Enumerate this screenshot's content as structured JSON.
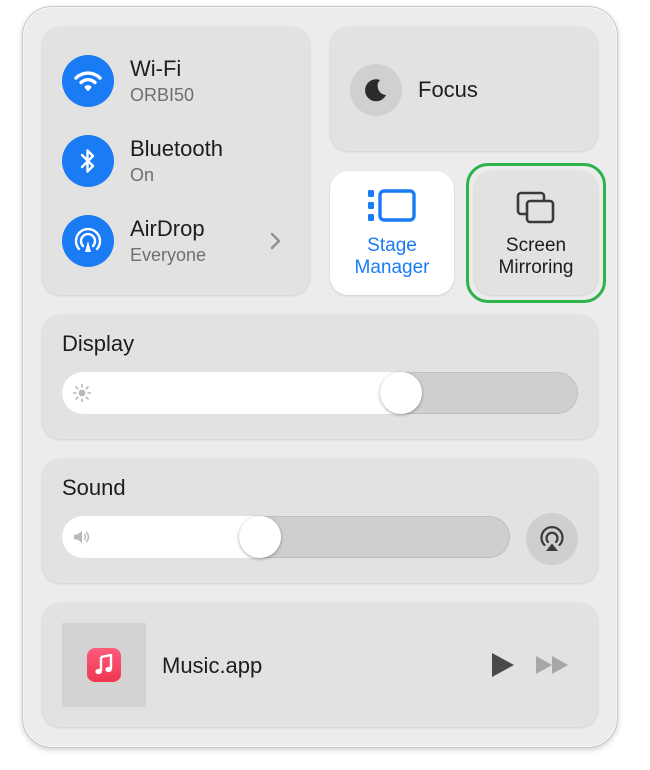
{
  "connectivity": {
    "wifi": {
      "title": "Wi-Fi",
      "subtitle": "ORBI50",
      "icon": "wifi-icon"
    },
    "bluetooth": {
      "title": "Bluetooth",
      "subtitle": "On",
      "icon": "bluetooth-icon"
    },
    "airdrop": {
      "title": "AirDrop",
      "subtitle": "Everyone",
      "icon": "airdrop-icon"
    }
  },
  "focus": {
    "label": "Focus",
    "icon": "moon-icon"
  },
  "stage_manager": {
    "line1": "Stage",
    "line2": "Manager",
    "icon": "stage-manager-icon"
  },
  "screen_mirroring": {
    "line1": "Screen",
    "line2": "Mirroring",
    "icon": "screen-mirroring-icon",
    "highlighted": true
  },
  "display": {
    "label": "Display",
    "brightness": 0.67,
    "icon": "sun-icon"
  },
  "sound": {
    "label": "Sound",
    "volume": 0.436,
    "icon": "speaker-icon",
    "output_icon": "airplay-audio-icon"
  },
  "now_playing": {
    "label": "Music.app",
    "app_icon": "music-note-icon"
  },
  "colors": {
    "accent": "#1a7cf5",
    "highlight": "#2cb34a",
    "music": "#f0364e"
  }
}
